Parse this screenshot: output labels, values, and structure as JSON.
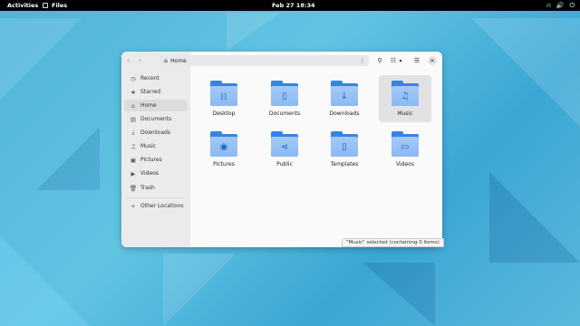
{
  "topbar": {
    "activities": "Activities",
    "app_name": "Files",
    "clock": "Feb 27  18:34",
    "tray": {
      "network_icon": "⛙",
      "volume_icon": "🔊",
      "power_icon": "⏻"
    }
  },
  "window": {
    "nav": {
      "back_icon": "‹",
      "forward_icon": "›"
    },
    "pathbar": {
      "home_icon": "⌂",
      "location": "Home",
      "menu_icon": "⋮"
    },
    "header_buttons": {
      "search_icon": "⚲",
      "view_icon": "☷",
      "view_dropdown_icon": "▾",
      "menu_icon": "☰",
      "close_icon": "✕"
    },
    "sidebar": {
      "items": [
        {
          "icon": "◷",
          "label": "Recent"
        },
        {
          "icon": "★",
          "label": "Starred"
        },
        {
          "icon": "⌂",
          "label": "Home"
        },
        {
          "icon": "▤",
          "label": "Documents"
        },
        {
          "icon": "⤓",
          "label": "Downloads"
        },
        {
          "icon": "♫",
          "label": "Music"
        },
        {
          "icon": "▣",
          "label": "Pictures"
        },
        {
          "icon": "▶",
          "label": "Videos"
        },
        {
          "icon": "🗑",
          "label": "Trash"
        }
      ],
      "other": {
        "icon": "+",
        "label": "Other Locations"
      }
    },
    "folders": [
      {
        "icon": "⁅⁆",
        "label": "Desktop"
      },
      {
        "icon": "▯",
        "label": "Documents"
      },
      {
        "icon": "↓",
        "label": "Downloads"
      },
      {
        "icon": "♫",
        "label": "Music"
      },
      {
        "icon": "◉",
        "label": "Pictures"
      },
      {
        "icon": "⋖",
        "label": "Public"
      },
      {
        "icon": "▯",
        "label": "Templates"
      },
      {
        "icon": "▭",
        "label": "Videos"
      }
    ],
    "status": "\"Music\" selected  (containing 0 items)"
  }
}
